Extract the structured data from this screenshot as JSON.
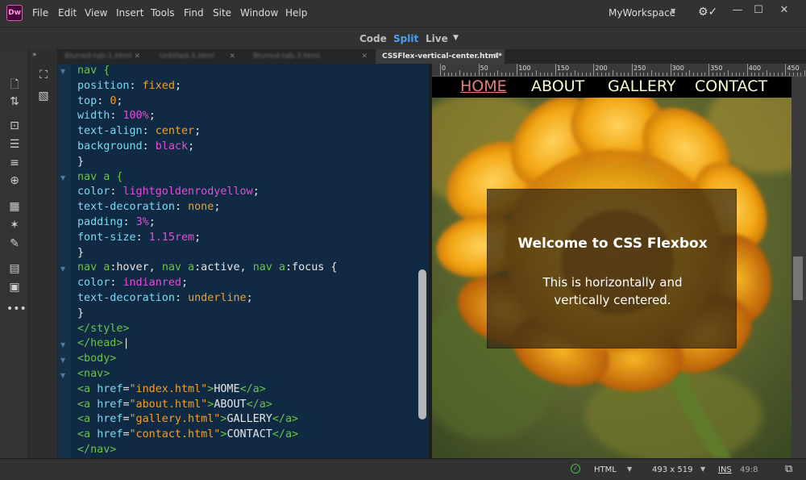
{
  "app": {
    "logo": "Dw",
    "menu": [
      "File",
      "Edit",
      "View",
      "Insert",
      "Tools",
      "Find",
      "Site",
      "Window",
      "Help"
    ],
    "workspace": "MyWorkspace",
    "sync_icon": "gear-sync-icon"
  },
  "views": {
    "code": "Code",
    "split": "Split",
    "live": "Live",
    "active": "Split",
    "active_color": "#4aa0f0"
  },
  "tabs": {
    "inactive": [
      {
        "label": "Blurred-tab-1.html"
      },
      {
        "label": "Untitled-3.html"
      },
      {
        "label": "Blurred-tab-3.html"
      }
    ],
    "active": "CSSFlex-vertical-center.html*"
  },
  "collapse": "»",
  "code_lines": [
    [
      [
        "nav {",
        "c-tag"
      ]
    ],
    [
      [
        "position",
        "c-prop"
      ],
      [
        ": ",
        "c-plain"
      ],
      [
        "fixed",
        "c-val"
      ],
      [
        ";",
        "c-plain"
      ]
    ],
    [
      [
        "top",
        "c-prop"
      ],
      [
        ": ",
        "c-plain"
      ],
      [
        "0",
        "c-val"
      ],
      [
        ";",
        "c-plain"
      ]
    ],
    [
      [
        "width",
        "c-prop"
      ],
      [
        ": ",
        "c-plain"
      ],
      [
        "100%",
        "c-kw"
      ],
      [
        ";",
        "c-plain"
      ]
    ],
    [
      [
        "text-align",
        "c-prop"
      ],
      [
        ": ",
        "c-plain"
      ],
      [
        "center",
        "c-val"
      ],
      [
        ";",
        "c-plain"
      ]
    ],
    [
      [
        "background",
        "c-prop"
      ],
      [
        ": ",
        "c-plain"
      ],
      [
        "black",
        "c-kw"
      ],
      [
        ";",
        "c-plain"
      ]
    ],
    [
      [
        "}",
        "c-plain"
      ]
    ],
    [
      [
        "nav a {",
        "c-tag"
      ]
    ],
    [
      [
        "color",
        "c-prop"
      ],
      [
        ": ",
        "c-plain"
      ],
      [
        "lightgoldenrodyellow",
        "c-kw"
      ],
      [
        ";",
        "c-plain"
      ]
    ],
    [
      [
        "text-decoration",
        "c-prop"
      ],
      [
        ": ",
        "c-plain"
      ],
      [
        "none",
        "c-val"
      ],
      [
        ";",
        "c-plain"
      ]
    ],
    [
      [
        "padding",
        "c-prop"
      ],
      [
        ": ",
        "c-plain"
      ],
      [
        "3%",
        "c-kw"
      ],
      [
        ";",
        "c-plain"
      ]
    ],
    [
      [
        "font-size",
        "c-prop"
      ],
      [
        ": ",
        "c-plain"
      ],
      [
        "1.15rem",
        "c-kw"
      ],
      [
        ";",
        "c-plain"
      ]
    ],
    [
      [
        "}",
        "c-plain"
      ]
    ],
    [
      [
        "nav a",
        "c-tag"
      ],
      [
        ":hover, ",
        "c-plain"
      ],
      [
        "nav a",
        "c-tag"
      ],
      [
        ":active, ",
        "c-plain"
      ],
      [
        "nav a",
        "c-tag"
      ],
      [
        ":focus {",
        "c-plain"
      ]
    ],
    [
      [
        "color",
        "c-prop"
      ],
      [
        ": ",
        "c-plain"
      ],
      [
        "indianred",
        "c-kw"
      ],
      [
        ";",
        "c-plain"
      ]
    ],
    [
      [
        "text-decoration",
        "c-prop"
      ],
      [
        ": ",
        "c-plain"
      ],
      [
        "underline",
        "c-val"
      ],
      [
        ";",
        "c-plain"
      ]
    ],
    [
      [
        "}",
        "c-plain"
      ]
    ],
    [
      [
        "</style>",
        "c-tag"
      ]
    ],
    [
      [
        "</head>",
        "c-tag"
      ],
      [
        "|",
        "c-plain"
      ]
    ],
    [
      [
        "<body>",
        "c-tag"
      ]
    ],
    [
      [
        "<nav>",
        "c-tag"
      ]
    ],
    [
      [
        "<a ",
        "c-tag"
      ],
      [
        "href",
        "c-attr"
      ],
      [
        "=",
        "c-plain"
      ],
      [
        "\"index.html\"",
        "c-str"
      ],
      [
        ">",
        "c-tag"
      ],
      [
        "HOME",
        "c-plain"
      ],
      [
        "</a>",
        "c-tag"
      ]
    ],
    [
      [
        "<a ",
        "c-tag"
      ],
      [
        "href",
        "c-attr"
      ],
      [
        "=",
        "c-plain"
      ],
      [
        "\"about.html\"",
        "c-str"
      ],
      [
        ">",
        "c-tag"
      ],
      [
        "ABOUT",
        "c-plain"
      ],
      [
        "</a>",
        "c-tag"
      ]
    ],
    [
      [
        "<a ",
        "c-tag"
      ],
      [
        "href",
        "c-attr"
      ],
      [
        "=",
        "c-plain"
      ],
      [
        "\"gallery.html\"",
        "c-str"
      ],
      [
        ">",
        "c-tag"
      ],
      [
        "GALLERY",
        "c-plain"
      ],
      [
        "</a>",
        "c-tag"
      ]
    ],
    [
      [
        "<a ",
        "c-tag"
      ],
      [
        "href",
        "c-attr"
      ],
      [
        "=",
        "c-plain"
      ],
      [
        "\"contact.html\"",
        "c-str"
      ],
      [
        ">",
        "c-tag"
      ],
      [
        "CONTACT",
        "c-plain"
      ],
      [
        "</a>",
        "c-tag"
      ]
    ],
    [
      [
        "</nav>",
        "c-tag"
      ]
    ]
  ],
  "ruler": [
    "0",
    "50",
    "100",
    "150",
    "200",
    "250",
    "300",
    "350",
    "400",
    "450"
  ],
  "preview": {
    "nav_links": [
      "HOME",
      "ABOUT",
      "GALLERY",
      "CONTACT"
    ],
    "title": "Welcome to CSS Flexbox",
    "text_line1": "This is horizontally and",
    "text_line2": "vertically centered."
  },
  "status": {
    "language": "HTML",
    "dimensions": "493 x 519",
    "mode": "INS",
    "position": "49:8",
    "check_icon": "check-circle-icon"
  }
}
